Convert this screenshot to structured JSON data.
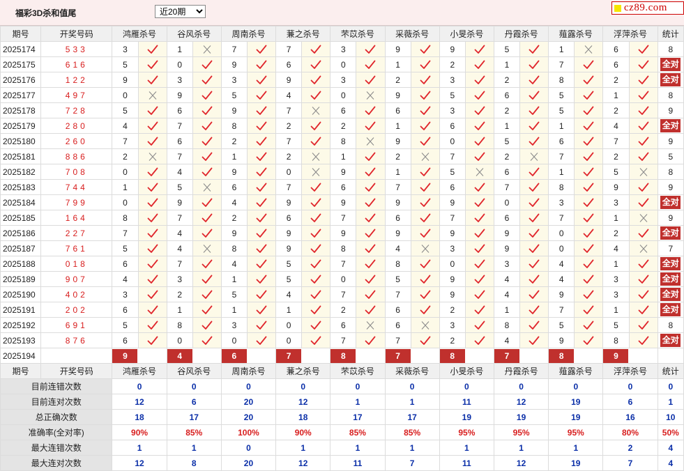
{
  "header": {
    "title": "福彩3D杀和值尾",
    "period_select": "近20期",
    "period_options": [
      "近20期"
    ],
    "logo_text": "cz89.com"
  },
  "columns": {
    "issue": "期号",
    "numbers": "开奖号码",
    "stat": "统计",
    "killers": [
      "鸿雁杀号",
      "谷风杀号",
      "周南杀号",
      "蒹之杀号",
      "芣苡杀号",
      "采薇杀号",
      "小旻杀号",
      "丹霞杀号",
      "薤露杀号",
      "浮萍杀号"
    ]
  },
  "rows": [
    {
      "issue": "2025174",
      "nums": "533",
      "k": [
        [
          3,
          1
        ],
        [
          1,
          0
        ],
        [
          7,
          1
        ],
        [
          7,
          1
        ],
        [
          3,
          1
        ],
        [
          9,
          1
        ],
        [
          9,
          1
        ],
        [
          5,
          1
        ],
        [
          1,
          0
        ],
        [
          6,
          1
        ]
      ],
      "stat": "8"
    },
    {
      "issue": "2025175",
      "nums": "616",
      "k": [
        [
          5,
          1
        ],
        [
          0,
          1
        ],
        [
          9,
          1
        ],
        [
          6,
          1
        ],
        [
          0,
          1
        ],
        [
          1,
          1
        ],
        [
          2,
          1
        ],
        [
          1,
          1
        ],
        [
          7,
          1
        ],
        [
          6,
          1
        ]
      ],
      "stat": "全对"
    },
    {
      "issue": "2025176",
      "nums": "122",
      "k": [
        [
          9,
          1
        ],
        [
          3,
          1
        ],
        [
          3,
          1
        ],
        [
          9,
          1
        ],
        [
          3,
          1
        ],
        [
          2,
          1
        ],
        [
          3,
          1
        ],
        [
          2,
          1
        ],
        [
          8,
          1
        ],
        [
          2,
          1
        ]
      ],
      "stat": "全对"
    },
    {
      "issue": "2025177",
      "nums": "497",
      "k": [
        [
          0,
          0
        ],
        [
          9,
          1
        ],
        [
          5,
          1
        ],
        [
          4,
          1
        ],
        [
          0,
          0
        ],
        [
          9,
          1
        ],
        [
          5,
          1
        ],
        [
          6,
          1
        ],
        [
          5,
          1
        ],
        [
          1,
          1
        ]
      ],
      "stat": "8"
    },
    {
      "issue": "2025178",
      "nums": "728",
      "k": [
        [
          5,
          1
        ],
        [
          6,
          1
        ],
        [
          9,
          1
        ],
        [
          7,
          0
        ],
        [
          6,
          1
        ],
        [
          6,
          1
        ],
        [
          3,
          1
        ],
        [
          2,
          1
        ],
        [
          5,
          1
        ],
        [
          2,
          1
        ]
      ],
      "stat": "9"
    },
    {
      "issue": "2025179",
      "nums": "280",
      "k": [
        [
          4,
          1
        ],
        [
          7,
          1
        ],
        [
          8,
          1
        ],
        [
          2,
          1
        ],
        [
          2,
          1
        ],
        [
          1,
          1
        ],
        [
          6,
          1
        ],
        [
          1,
          1
        ],
        [
          1,
          1
        ],
        [
          4,
          1
        ]
      ],
      "stat": "全对"
    },
    {
      "issue": "2025180",
      "nums": "260",
      "k": [
        [
          7,
          1
        ],
        [
          6,
          1
        ],
        [
          2,
          1
        ],
        [
          7,
          1
        ],
        [
          8,
          0
        ],
        [
          9,
          1
        ],
        [
          0,
          1
        ],
        [
          5,
          1
        ],
        [
          6,
          1
        ],
        [
          7,
          1
        ]
      ],
      "stat": "9"
    },
    {
      "issue": "2025181",
      "nums": "886",
      "k": [
        [
          2,
          0
        ],
        [
          7,
          1
        ],
        [
          1,
          1
        ],
        [
          2,
          0
        ],
        [
          1,
          1
        ],
        [
          2,
          0
        ],
        [
          7,
          1
        ],
        [
          2,
          0
        ],
        [
          7,
          1
        ],
        [
          2,
          1
        ]
      ],
      "stat": "5"
    },
    {
      "issue": "2025182",
      "nums": "708",
      "k": [
        [
          0,
          1
        ],
        [
          4,
          1
        ],
        [
          9,
          1
        ],
        [
          0,
          0
        ],
        [
          9,
          1
        ],
        [
          1,
          1
        ],
        [
          5,
          0
        ],
        [
          6,
          1
        ],
        [
          1,
          1
        ],
        [
          5,
          0
        ]
      ],
      "stat": "8"
    },
    {
      "issue": "2025183",
      "nums": "744",
      "k": [
        [
          1,
          1
        ],
        [
          5,
          0
        ],
        [
          6,
          1
        ],
        [
          7,
          1
        ],
        [
          6,
          1
        ],
        [
          7,
          1
        ],
        [
          6,
          1
        ],
        [
          7,
          1
        ],
        [
          8,
          1
        ],
        [
          9,
          1
        ]
      ],
      "stat": "9"
    },
    {
      "issue": "2025184",
      "nums": "799",
      "k": [
        [
          0,
          1
        ],
        [
          9,
          1
        ],
        [
          4,
          1
        ],
        [
          9,
          1
        ],
        [
          9,
          1
        ],
        [
          9,
          1
        ],
        [
          9,
          1
        ],
        [
          0,
          1
        ],
        [
          3,
          1
        ],
        [
          3,
          1
        ]
      ],
      "stat": "全对"
    },
    {
      "issue": "2025185",
      "nums": "164",
      "k": [
        [
          8,
          1
        ],
        [
          7,
          1
        ],
        [
          2,
          1
        ],
        [
          6,
          1
        ],
        [
          7,
          1
        ],
        [
          6,
          1
        ],
        [
          7,
          1
        ],
        [
          6,
          1
        ],
        [
          7,
          1
        ],
        [
          1,
          0
        ]
      ],
      "stat": "9"
    },
    {
      "issue": "2025186",
      "nums": "227",
      "k": [
        [
          7,
          1
        ],
        [
          4,
          1
        ],
        [
          9,
          1
        ],
        [
          9,
          1
        ],
        [
          9,
          1
        ],
        [
          9,
          1
        ],
        [
          9,
          1
        ],
        [
          9,
          1
        ],
        [
          0,
          1
        ],
        [
          2,
          1
        ]
      ],
      "stat": "全对"
    },
    {
      "issue": "2025187",
      "nums": "761",
      "k": [
        [
          5,
          1
        ],
        [
          4,
          0
        ],
        [
          8,
          1
        ],
        [
          9,
          1
        ],
        [
          8,
          1
        ],
        [
          4,
          0
        ],
        [
          3,
          1
        ],
        [
          9,
          1
        ],
        [
          0,
          1
        ],
        [
          4,
          0
        ]
      ],
      "stat": "7"
    },
    {
      "issue": "2025188",
      "nums": "018",
      "k": [
        [
          6,
          1
        ],
        [
          7,
          1
        ],
        [
          4,
          1
        ],
        [
          5,
          1
        ],
        [
          7,
          1
        ],
        [
          8,
          1
        ],
        [
          0,
          1
        ],
        [
          3,
          1
        ],
        [
          4,
          1
        ],
        [
          1,
          1
        ]
      ],
      "stat": "全对"
    },
    {
      "issue": "2025189",
      "nums": "907",
      "k": [
        [
          4,
          1
        ],
        [
          3,
          1
        ],
        [
          1,
          1
        ],
        [
          5,
          1
        ],
        [
          0,
          1
        ],
        [
          5,
          1
        ],
        [
          9,
          1
        ],
        [
          4,
          1
        ],
        [
          4,
          1
        ],
        [
          3,
          1
        ]
      ],
      "stat": "全对"
    },
    {
      "issue": "2025190",
      "nums": "402",
      "k": [
        [
          3,
          1
        ],
        [
          2,
          1
        ],
        [
          5,
          1
        ],
        [
          4,
          1
        ],
        [
          7,
          1
        ],
        [
          7,
          1
        ],
        [
          9,
          1
        ],
        [
          4,
          1
        ],
        [
          9,
          1
        ],
        [
          3,
          1
        ]
      ],
      "stat": "全对"
    },
    {
      "issue": "2025191",
      "nums": "202",
      "k": [
        [
          6,
          1
        ],
        [
          1,
          1
        ],
        [
          1,
          1
        ],
        [
          1,
          1
        ],
        [
          2,
          1
        ],
        [
          6,
          1
        ],
        [
          2,
          1
        ],
        [
          1,
          1
        ],
        [
          7,
          1
        ],
        [
          1,
          1
        ]
      ],
      "stat": "全对"
    },
    {
      "issue": "2025192",
      "nums": "691",
      "k": [
        [
          5,
          1
        ],
        [
          8,
          1
        ],
        [
          3,
          1
        ],
        [
          0,
          1
        ],
        [
          6,
          0
        ],
        [
          6,
          0
        ],
        [
          3,
          1
        ],
        [
          8,
          1
        ],
        [
          5,
          1
        ],
        [
          5,
          1
        ]
      ],
      "stat": "8"
    },
    {
      "issue": "2025193",
      "nums": "876",
      "k": [
        [
          6,
          1
        ],
        [
          0,
          1
        ],
        [
          0,
          1
        ],
        [
          0,
          1
        ],
        [
          7,
          1
        ],
        [
          7,
          1
        ],
        [
          2,
          1
        ],
        [
          4,
          1
        ],
        [
          9,
          1
        ],
        [
          8,
          1
        ]
      ],
      "stat": "全对"
    }
  ],
  "current": {
    "issue": "2025194",
    "label": "当前期杀号",
    "values": [
      "9",
      "4",
      "6",
      "7",
      "8",
      "7",
      "8",
      "7",
      "8",
      "9"
    ]
  },
  "stats": {
    "rows": [
      {
        "label": "目前连错次数",
        "values": [
          "0",
          "0",
          "0",
          "0",
          "0",
          "0",
          "0",
          "0",
          "0",
          "0"
        ],
        "stat": "0",
        "pct": false
      },
      {
        "label": "目前连对次数",
        "values": [
          "12",
          "6",
          "20",
          "12",
          "1",
          "1",
          "11",
          "12",
          "19",
          "6"
        ],
        "stat": "1",
        "pct": false
      },
      {
        "label": "总正确次数",
        "values": [
          "18",
          "17",
          "20",
          "18",
          "17",
          "17",
          "19",
          "19",
          "19",
          "16"
        ],
        "stat": "10",
        "pct": false
      },
      {
        "label": "准确率(全对率)",
        "values": [
          "90%",
          "85%",
          "100%",
          "90%",
          "85%",
          "85%",
          "95%",
          "95%",
          "95%",
          "80%"
        ],
        "stat": "50%",
        "pct": true
      },
      {
        "label": "最大连错次数",
        "values": [
          "1",
          "1",
          "0",
          "1",
          "1",
          "1",
          "1",
          "1",
          "1",
          "2"
        ],
        "stat": "4",
        "pct": false
      },
      {
        "label": "最大连对次数",
        "values": [
          "12",
          "8",
          "20",
          "12",
          "11",
          "7",
          "11",
          "12",
          "19",
          "7"
        ],
        "stat": "4",
        "pct": false
      }
    ]
  },
  "colors": {
    "accent_red": "#c0302d",
    "number_red": "#d81e1e",
    "stat_blue": "#0b2fa8",
    "mark_bg": "#fdfae8",
    "check": "#e0262c",
    "cross": "#8c8c8c"
  }
}
